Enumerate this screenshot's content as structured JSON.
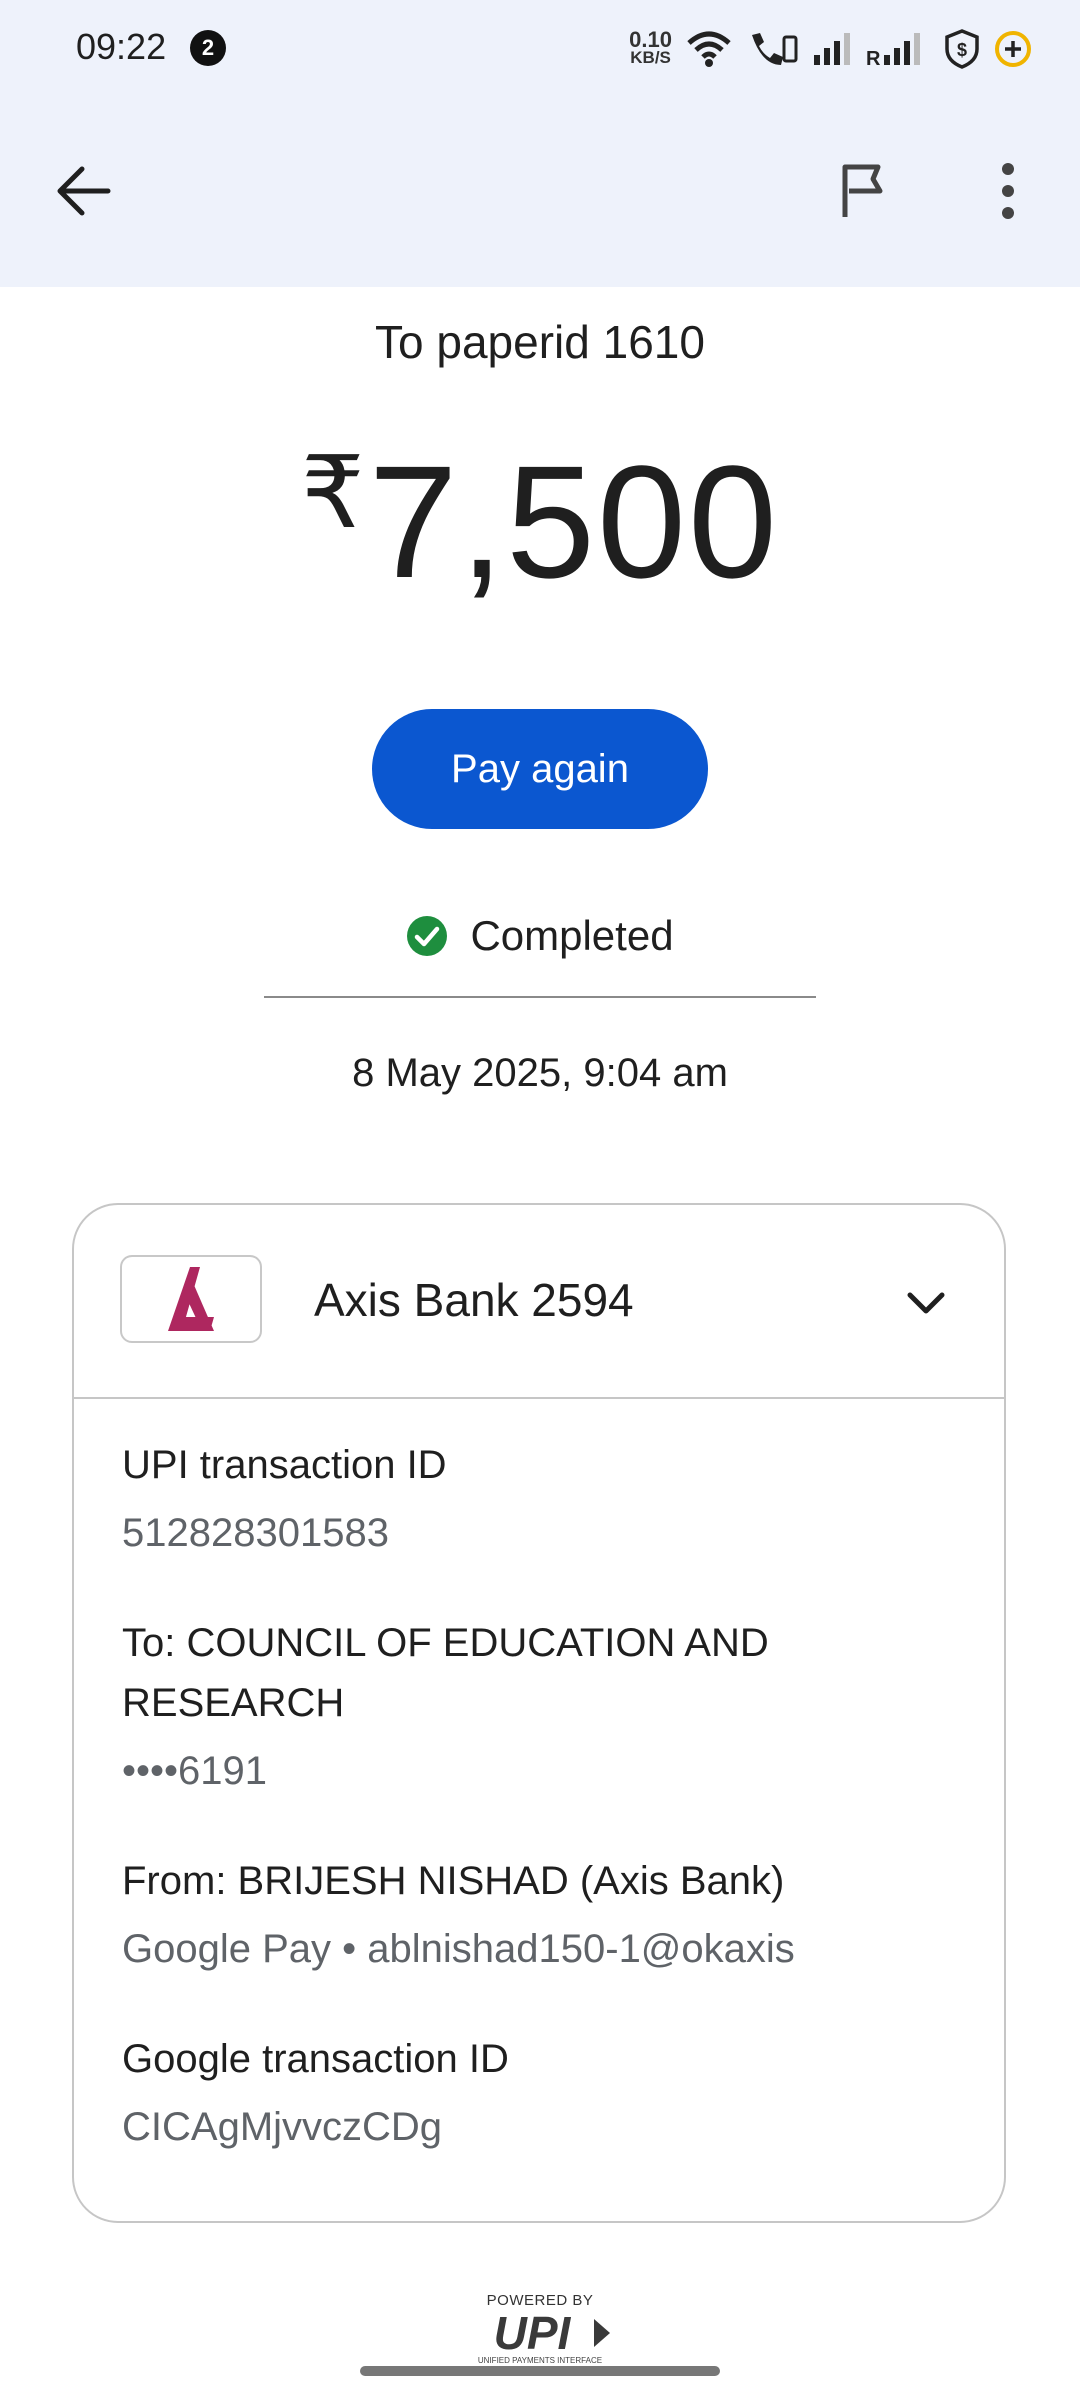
{
  "status_bar": {
    "time": "09:22",
    "notification_count": "2",
    "speed_value": "0.10",
    "speed_unit": "KB/S"
  },
  "header": {
    "icons": [
      "back-arrow-icon",
      "flag-icon",
      "more-vert-icon"
    ]
  },
  "payment": {
    "recipient": "To paperid 1610",
    "currency": "₹",
    "amount": "7,500",
    "pay_again_label": "Pay again",
    "status": "Completed",
    "datetime": "8 May 2025, 9:04 am"
  },
  "colors": {
    "header_bg": "#eef2fb",
    "primary": "#0b57d0",
    "success": "#1e8e3e",
    "axis_brand": "#ae275f"
  },
  "details": {
    "bank": "Axis Bank 2594",
    "upi_id_label": "UPI transaction ID",
    "upi_id_value": "512828301583",
    "to_label": "To: COUNCIL OF EDUCATION AND RESEARCH",
    "to_value": "••••6191",
    "from_label": "From: BRIJESH NISHAD (Axis Bank)",
    "from_value": "Google Pay • ablnishad150-1@okaxis",
    "google_id_label": "Google transaction ID",
    "google_id_value": "CICAgMjvvczCDg"
  },
  "footer": {
    "powered_by": "POWERED BY",
    "upi_text": "UPI",
    "upi_subtext": "UNIFIED PAYMENTS INTERFACE"
  }
}
